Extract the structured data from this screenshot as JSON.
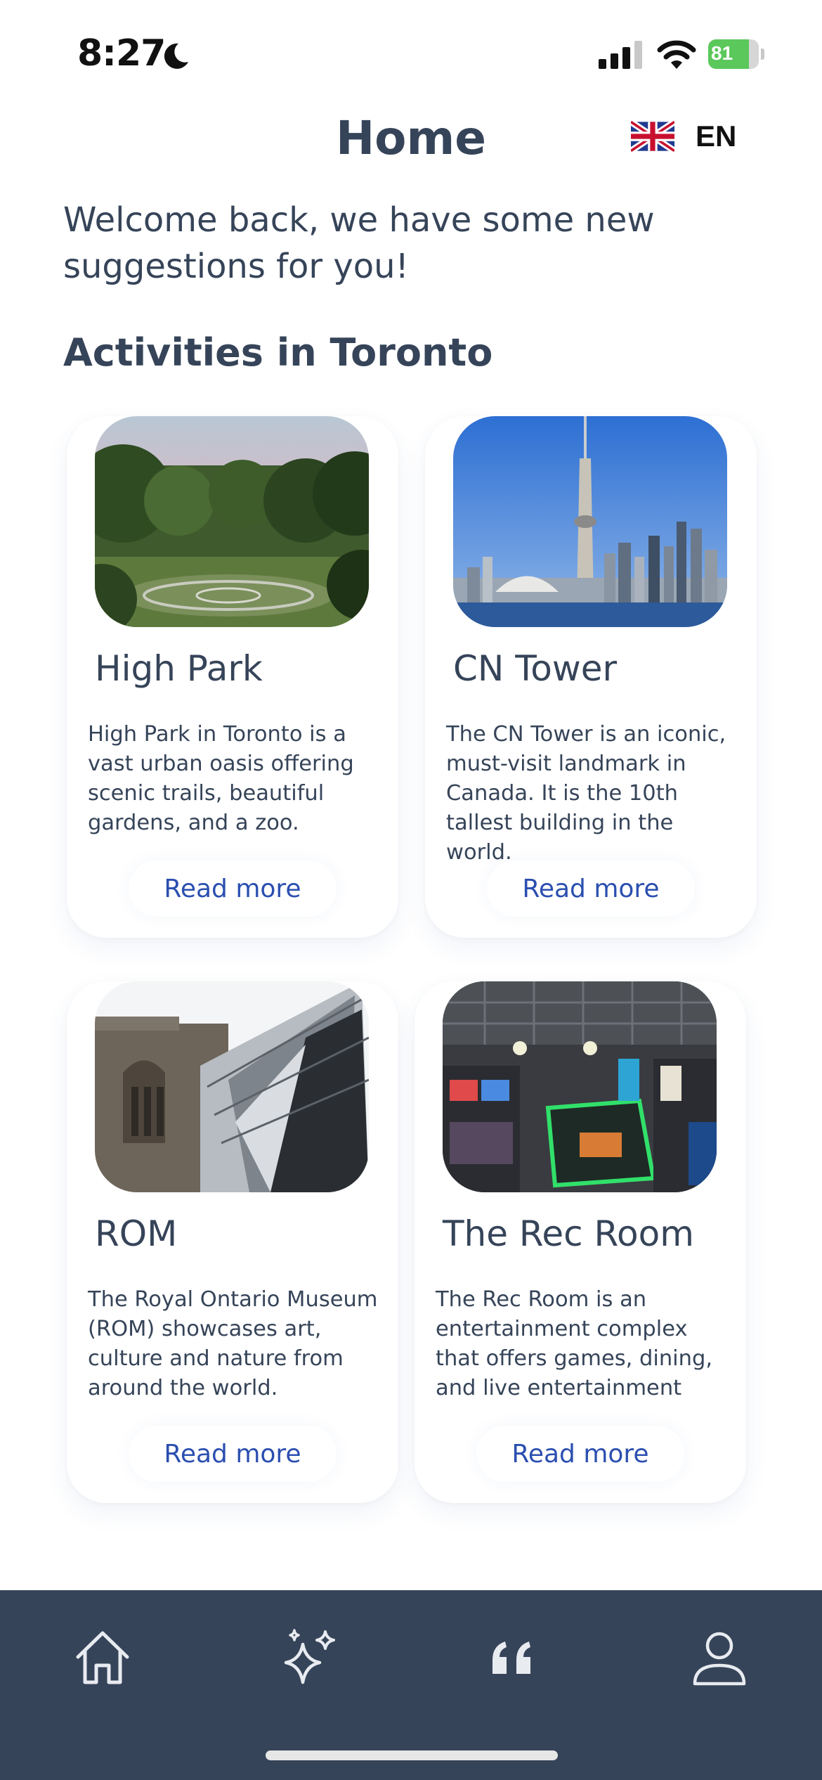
{
  "status_bar": {
    "time": "8:27",
    "battery": "81",
    "battery_level": 0.81,
    "battery_color": "#5ac85a"
  },
  "header": {
    "title": "Home",
    "language": "EN",
    "flag": "uk-flag-icon"
  },
  "welcome_text": "Welcome back, we have some new suggestions for you!",
  "section_title": "Activities in Toronto",
  "cards": [
    {
      "title": "High Park",
      "description": "High Park in Toronto is a vast urban oasis offering scenic trails, beautiful gardens, and a zoo.",
      "button": "Read more",
      "image": "high-park-photo"
    },
    {
      "title": "CN Tower",
      "description": "The CN Tower is an iconic, must-visit landmark in Canada. It is the 10th tallest building in the world.",
      "button": "Read more",
      "image": "cn-tower-photo"
    },
    {
      "title": "ROM",
      "description": "The Royal Ontario Museum (ROM) showcases art, culture and nature from around the world.",
      "button": "Read more",
      "image": "rom-photo"
    },
    {
      "title": "The Rec Room",
      "description": "The Rec Room is an entertainment complex that offers games, dining, and live entertainment",
      "button": "Read more",
      "image": "rec-room-photo"
    }
  ],
  "tab_bar": {
    "background": "#364459",
    "tabs": [
      {
        "icon": "home-icon"
      },
      {
        "icon": "sparkles-icon"
      },
      {
        "icon": "quote-icon"
      },
      {
        "icon": "profile-icon"
      }
    ]
  },
  "colors": {
    "text": "#364459",
    "link": "#2b4fb0"
  }
}
